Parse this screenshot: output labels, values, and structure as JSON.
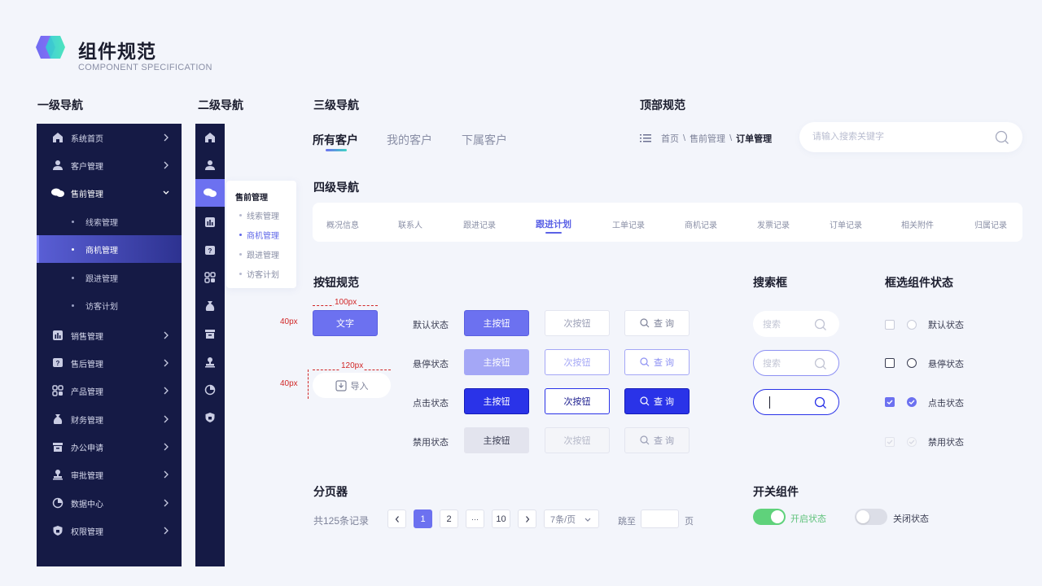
{
  "header": {
    "title": "组件规范",
    "subtitle": "COMPONENT SPECIFICATION"
  },
  "sections": {
    "nav1": "一级导航",
    "nav2": "二级导航",
    "nav3": "三级导航",
    "top": "顶部规范",
    "nav4": "四级导航",
    "buttons": "按钮规范",
    "search": "搜索框",
    "checkbox": "框选组件状态",
    "pagination": "分页器",
    "switch": "开关组件"
  },
  "nav1": {
    "items": [
      {
        "label": "系统首页",
        "icon": "home-icon"
      },
      {
        "label": "客户管理",
        "icon": "user-icon"
      },
      {
        "label": "售前管理",
        "icon": "chat-icon"
      },
      {
        "label": "销售管理",
        "icon": "chart-icon"
      },
      {
        "label": "售后管理",
        "icon": "question-icon"
      },
      {
        "label": "产品管理",
        "icon": "grid-icon"
      },
      {
        "label": "财务管理",
        "icon": "money-bag-icon"
      },
      {
        "label": "办公申请",
        "icon": "box-icon"
      },
      {
        "label": "审批管理",
        "icon": "stamp-icon"
      },
      {
        "label": "数据中心",
        "icon": "pie-icon"
      },
      {
        "label": "权限管理",
        "icon": "shield-icon"
      }
    ],
    "subitems": [
      "线索管理",
      "商机管理",
      "跟进管理",
      "访客计划"
    ],
    "active_sub": "商机管理"
  },
  "nav2": {
    "flyout_title": "售前管理",
    "flyout_items": [
      "线索管理",
      "商机管理",
      "跟进管理",
      "访客计划"
    ],
    "active": "商机管理"
  },
  "nav3": {
    "tabs": [
      "所有客户",
      "我的客户",
      "下属客户"
    ],
    "active": "所有客户"
  },
  "top": {
    "breadcrumb": [
      "首页",
      "售前管理",
      "订单管理"
    ],
    "separator": "\\",
    "search_placeholder": "请输入搜索关键字"
  },
  "nav4": {
    "tabs": [
      "概况信息",
      "联系人",
      "跟进记录",
      "跟进计划",
      "工单记录",
      "商机记录",
      "发票记录",
      "订单记录",
      "相关附件",
      "归属记录"
    ],
    "active": "跟进计划"
  },
  "buttons": {
    "width_note1": "100px",
    "width_note2": "120px",
    "height_note": "40px",
    "text_btn": "文字",
    "import_btn": "导入",
    "states": [
      "默认状态",
      "悬停状态",
      "点击状态",
      "禁用状态"
    ],
    "primary": "主按钮",
    "secondary": "次按钮",
    "query": "查 询"
  },
  "search": {
    "placeholder": "搜索"
  },
  "checkbox": {
    "states": [
      "默认状态",
      "悬停状态",
      "点击状态",
      "禁用状态"
    ]
  },
  "pagination": {
    "total": "共125条记录",
    "pages": [
      "1",
      "2",
      "···",
      "10"
    ],
    "active_page": "1",
    "page_size": "7条/页",
    "goto_label": "跳至",
    "page_unit": "页"
  },
  "switch": {
    "on_label": "开启状态",
    "off_label": "关闭状态"
  },
  "colors": {
    "primary": "#6c71f0",
    "nav_bg": "#151a45",
    "active_blue": "#2a33e8",
    "switch_on": "#5fd27b"
  }
}
